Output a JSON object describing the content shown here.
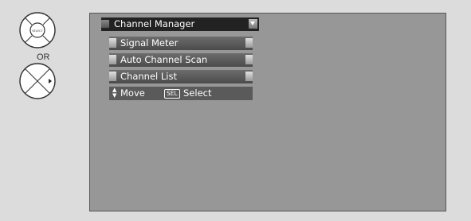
{
  "remote": {
    "select_button_label": "SELECT",
    "or_label": "OR"
  },
  "menu": {
    "title": "Channel Manager",
    "items": [
      {
        "label": "Signal Meter"
      },
      {
        "label": "Auto Channel Scan"
      },
      {
        "label": "Channel List"
      }
    ],
    "hints": {
      "move_label": "Move",
      "sel_key": "SEL",
      "select_label": "Select"
    }
  },
  "colors": {
    "screen_bg": "#979797",
    "title_bg": "#222222",
    "item_bg": "#5a5a5a",
    "page_bg": "#dcdcdc"
  }
}
